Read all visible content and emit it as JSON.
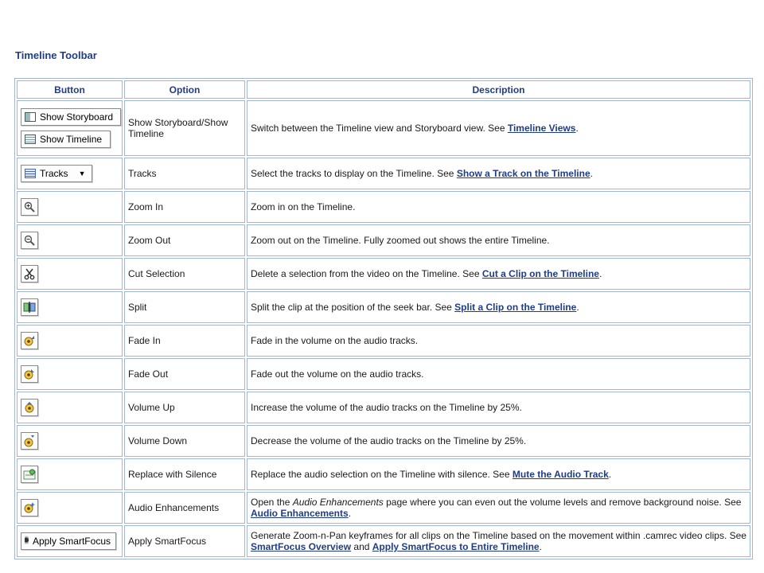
{
  "title": "Timeline Toolbar",
  "columns": {
    "button": "Button",
    "option": "Option",
    "description": "Description"
  },
  "buttons": {
    "show_storyboard": "Show Storyboard",
    "show_timeline": "Show Timeline",
    "tracks": "Tracks",
    "apply_smartfocus": "Apply SmartFocus"
  },
  "rows": [
    {
      "option": "Show Storyboard/Show Timeline",
      "desc": "Switch between the Timeline view and Storyboard view. See ",
      "link": "Timeline Views",
      "after": "."
    },
    {
      "option": "Tracks",
      "desc": "Select the tracks to display on the Timeline. See ",
      "link": "Show a Track on the Timeline",
      "after": "."
    },
    {
      "option": "Zoom In",
      "desc": "Zoom in on the Timeline.",
      "icon": "zoom-in-icon"
    },
    {
      "option": "Zoom Out",
      "desc": "Zoom out on the Timeline. Fully zoomed out shows the entire Timeline.",
      "icon": "zoom-out-icon"
    },
    {
      "option": "Cut Selection",
      "desc": "Delete a selection from the video on the Timeline. See ",
      "link": "Cut a Clip on the Timeline",
      "after": ".",
      "icon": "scissors-icon"
    },
    {
      "option": "Split",
      "desc": "Split the clip at the position of the seek bar. See ",
      "link": "Split a Clip on the Timeline",
      "after": ".",
      "icon": "split-icon"
    },
    {
      "option": "Fade In",
      "desc": "Fade in the volume on the audio tracks.",
      "icon": "fade-in-icon"
    },
    {
      "option": "Fade Out",
      "desc": "Fade out the volume on the audio tracks.",
      "icon": "fade-out-icon"
    },
    {
      "option": "Volume Up",
      "desc": "Increase the volume of the audio tracks on the Timeline by 25%.",
      "icon": "volume-up-icon"
    },
    {
      "option": "Volume Down",
      "desc": "Decrease the volume of the audio tracks on the Timeline by 25%.",
      "icon": "volume-down-icon"
    },
    {
      "option": "Replace with Silence",
      "desc": "Replace the audio selection on the Timeline with silence. See ",
      "link": "Mute the Audio Track",
      "after": ".",
      "icon": "silence-icon"
    },
    {
      "option": "Audio Enhancements",
      "desc_pre": "Open the ",
      "desc_em": "Audio Enhancements",
      "desc_post": " page where you can even out the volume levels and remove background noise. See ",
      "link": "Audio Enhancements",
      "after": ".",
      "icon": "audio-enhancements-icon"
    },
    {
      "option": "Apply SmartFocus",
      "desc": "Generate Zoom-n-Pan keyframes for all clips on the Timeline based on the movement within .camrec video clips. See ",
      "link": "SmartFocus Overview",
      "mid": " and ",
      "link2": "Apply SmartFocus to Entire Timeline",
      "after": "."
    }
  ]
}
